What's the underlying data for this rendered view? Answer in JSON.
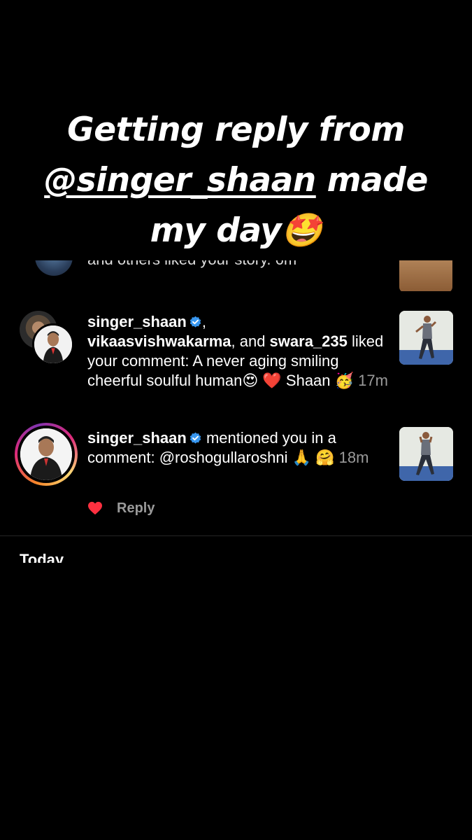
{
  "caption": {
    "line1": "Getting reply from",
    "mention": "@singer_shaan",
    "line2_rest": " made",
    "line3": "my day🤩"
  },
  "previous": {
    "text": "and others liked your story. 6m"
  },
  "notifications": [
    {
      "user1": "singer_shaan",
      "user2": "vikaasvishwakarma",
      "user3": "swara_235",
      "joiner_comma": ",",
      "joiner_and": ", and ",
      "action": "liked your comment: A never aging smiling cheerful soulful human😍 ❤️ Shaan 🥳",
      "time": "17m"
    },
    {
      "user1": "singer_shaan",
      "action": " mentioned you in a comment: @roshogullaroshni 🙏 🤗",
      "time": "18m",
      "reply_label": "Reply"
    }
  ],
  "section": {
    "today": "Today"
  },
  "colors": {
    "verified": "#3897f0",
    "heart": "#ff3040",
    "muted": "#9a9a9a"
  }
}
